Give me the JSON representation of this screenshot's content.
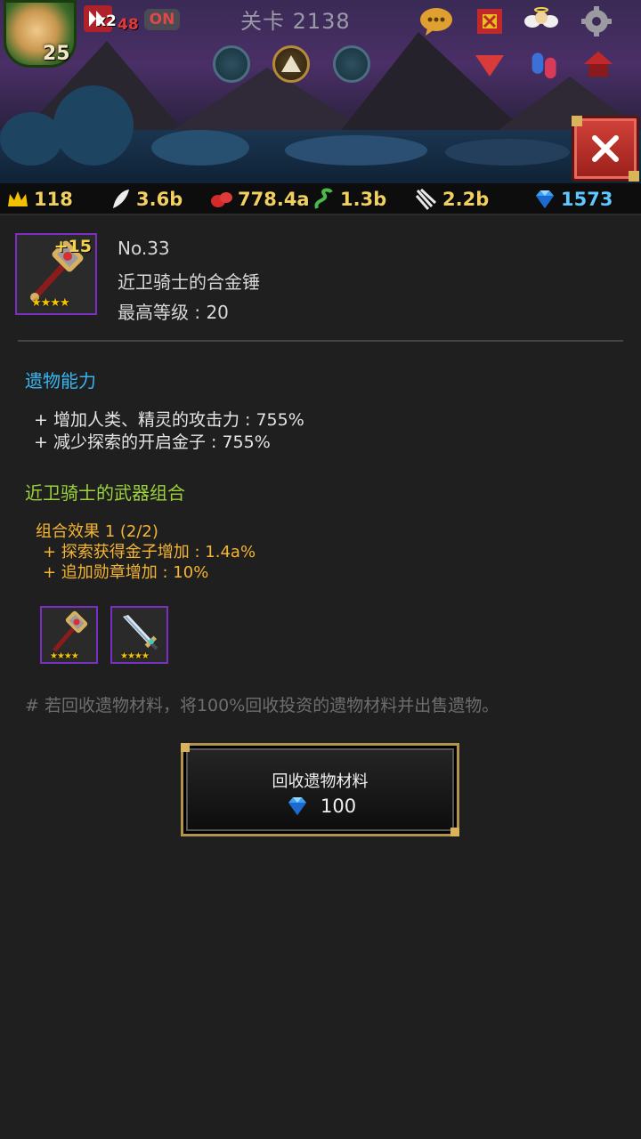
{
  "header": {
    "player_level": "25",
    "speed_multiplier": "x2",
    "speed_time": "48",
    "auto_toggle": "ON",
    "stage": "关卡 2138"
  },
  "resources": [
    {
      "icon": "crown-icon",
      "value": "118",
      "color": "#f2d060"
    },
    {
      "icon": "feather-icon",
      "value": "3.6b",
      "color": "#f2d060"
    },
    {
      "icon": "meat-icon",
      "value": "778.4a",
      "color": "#f2d060"
    },
    {
      "icon": "vine-icon",
      "value": "1.3b",
      "color": "#f2d060"
    },
    {
      "icon": "claw-icon",
      "value": "2.2b",
      "color": "#f2d060"
    },
    {
      "icon": "diamond-icon",
      "value": "1573",
      "color": "#5fc8ff"
    }
  ],
  "relic": {
    "plus_level": "+15",
    "stars": "★★★★",
    "number": "No.33",
    "name": "近卫骑士的合金锤",
    "max_level": "最高等级 : 20"
  },
  "ability": {
    "title": "遗物能力",
    "lines": [
      "+ 增加人类、精灵的攻击力 : 755%",
      "+ 减少探索的开启金子 : 755%"
    ]
  },
  "combo": {
    "title": "近卫骑士的武器组合",
    "effect_title": "组合效果 1 (2/2)",
    "lines": [
      "+ 探索获得金子增加 : 1.4a%",
      "+ 追加勋章增加 : 10%"
    ],
    "items": [
      {
        "icon": "hammer-icon",
        "stars": "★★★★"
      },
      {
        "icon": "sword-icon",
        "stars": "★★★★"
      }
    ]
  },
  "note": "# 若回收遗物材料，将100%回收投资的遗物材料并出售遗物。",
  "recycle_button": {
    "label": "回收遗物材料",
    "cost": "100"
  },
  "colors": {
    "accent_blue": "#37b6f0",
    "accent_green": "#9cd23a",
    "combo_orange": "#f5b533",
    "rarity_purple": "#7a2fc0",
    "close_red": "#d2423a"
  }
}
